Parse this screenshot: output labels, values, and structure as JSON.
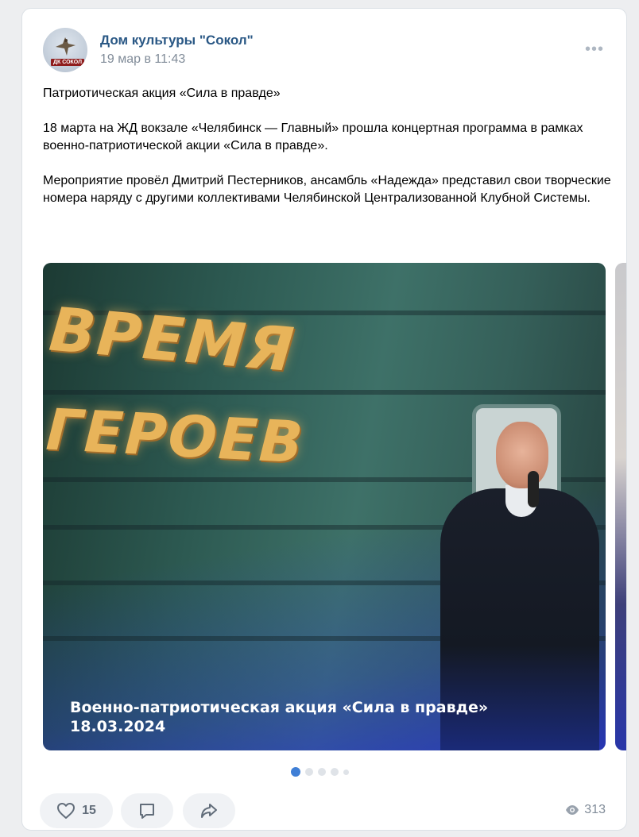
{
  "post": {
    "author": "Дом культуры \"Сокол\"",
    "date": "19 мар в 11:43",
    "avatar_text": "ДК СОКОЛ",
    "more_label": "•••",
    "paragraphs": [
      "Патриотическая акция «Сила в правде»",
      "18 марта на ЖД вокзале «Челябинск — Главный» прошла концертная программа в рамках военно-патриотической акции «Сила в правде».",
      "Мероприятие провёл Дмитрий Пестерников, ансамбль «Надежда» представил свои творческие номера наряду с другими коллективами Челябинской Централизованной Клубной Системы."
    ]
  },
  "gallery": {
    "image_word_1": "ВРЕМЯ",
    "image_word_2": "ГЕРОЕВ",
    "caption_line_1": "Военно-патриотическая  акция «Сила в правде»",
    "caption_line_2": "18.03.2024",
    "dots_total": 5,
    "active_index": 0
  },
  "actions": {
    "likes": "15",
    "views": "313",
    "like_icon": "heart-icon",
    "comment_icon": "comment-icon",
    "share_icon": "share-icon",
    "views_icon": "eye-icon"
  },
  "colors": {
    "author": "#2a5885",
    "muted": "#818c99",
    "pill_bg": "#f0f2f5",
    "active_dot": "#3f7fd6"
  }
}
